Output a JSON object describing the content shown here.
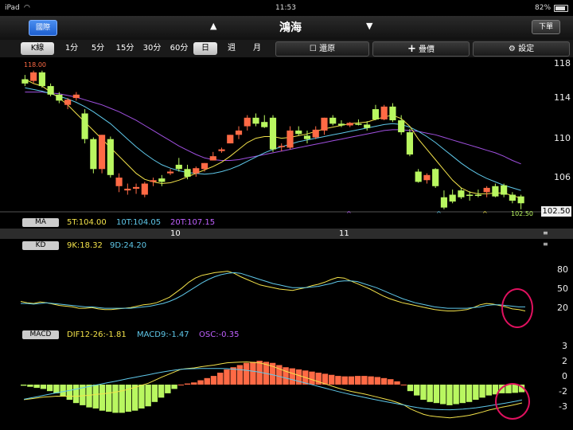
{
  "status": {
    "device": "iPad",
    "time": "11:53",
    "battery": "82%"
  },
  "header": {
    "left_button": "國際",
    "title": "鴻海",
    "right_button": "下單"
  },
  "tabs": [
    {
      "label": "K線",
      "selected": true
    },
    {
      "label": "1分",
      "selected": false
    },
    {
      "label": "5分",
      "selected": false
    },
    {
      "label": "15分",
      "selected": false
    },
    {
      "label": "30分",
      "selected": false
    },
    {
      "label": "60分",
      "selected": false
    },
    {
      "label": "日",
      "selected": true
    },
    {
      "label": "週",
      "selected": false
    },
    {
      "label": "月",
      "selected": false
    }
  ],
  "tools": {
    "restore": "還原",
    "overlay": "疊價",
    "settings": "設定"
  },
  "main": {
    "high_label": "118.00",
    "low_label": "102.50",
    "last_price": "102.50",
    "axis_labels": [
      "118",
      "114",
      "110",
      "106"
    ]
  },
  "ma_legend": {
    "tag": "MA",
    "t5": "5T:104.00",
    "t10": "10T:104.05",
    "t20": "20T:107.15"
  },
  "dates": [
    "10",
    "11"
  ],
  "kd_legend": {
    "tag": "KD",
    "k": "9K:18.32",
    "d": "9D:24.20"
  },
  "kd_axis": [
    "80",
    "50",
    "20"
  ],
  "macd_legend": {
    "tag": "MACD",
    "dif": "DIF12-26:-1.81",
    "macd": "MACD9:-1.47",
    "osc": "OSC:-0.35"
  },
  "macd_axis": [
    "3",
    "2",
    "0",
    "-2",
    "-3"
  ],
  "colors": {
    "up": "#ff6a45",
    "down": "#b9f760",
    "ma5": "#f3e24a",
    "ma10": "#5fc8ea",
    "ma20": "#a050e0",
    "circle": "#e0115f"
  },
  "chart_data": [
    {
      "type": "candlestick",
      "title": "",
      "ylim": [
        101.5,
        119
      ],
      "candles": [
        [
          117,
          117.5,
          116.2,
          116.5
        ],
        [
          116.8,
          118,
          116.5,
          117.8
        ],
        [
          117.8,
          118,
          116,
          116.2
        ],
        [
          116.2,
          116.5,
          115,
          115.2
        ],
        [
          115.2,
          115.5,
          114.2,
          114.5
        ],
        [
          114,
          114.8,
          113.5,
          114.6
        ],
        [
          114.8,
          115.5,
          114.5,
          115.2
        ],
        [
          113,
          113.5,
          109.5,
          110
        ],
        [
          110,
          110.2,
          106,
          106.5
        ],
        [
          106.5,
          110.5,
          106,
          110.5
        ],
        [
          110,
          110.3,
          105.5,
          105.8
        ],
        [
          104.5,
          106,
          103.8,
          105.5
        ],
        [
          104,
          104.8,
          103.5,
          104.2
        ],
        [
          104.2,
          104.8,
          103.6,
          104.4
        ],
        [
          103.5,
          105,
          103.2,
          104.8
        ],
        [
          105,
          105.5,
          104.5,
          105.2
        ],
        [
          105.4,
          105.8,
          104.5,
          105
        ],
        [
          106,
          106.5,
          105.8,
          106.2
        ],
        [
          107,
          107.8,
          106.2,
          106.5
        ],
        [
          106.5,
          107,
          105.3,
          105.6
        ],
        [
          106,
          106.8,
          105.6,
          106.6
        ],
        [
          106.5,
          107.2,
          106.2,
          107.2
        ],
        [
          107.5,
          108.5,
          107.5,
          108
        ],
        [
          108.6,
          109,
          108.4,
          108.8
        ],
        [
          109.5,
          110.5,
          109.5,
          110.5
        ],
        [
          110.5,
          111.5,
          110,
          111
        ],
        [
          111.5,
          112.8,
          111,
          112.5
        ],
        [
          112.5,
          113,
          111.5,
          111.8
        ],
        [
          112,
          112.8,
          111.3,
          111.4
        ],
        [
          112.5,
          112.8,
          108.5,
          108.8
        ],
        [
          109.2,
          109.5,
          108.6,
          109.2
        ],
        [
          109,
          111.5,
          108.8,
          111
        ],
        [
          111,
          111.5,
          110.4,
          110.6
        ],
        [
          110.4,
          111,
          109.5,
          110
        ],
        [
          110.2,
          111.5,
          110,
          111.1
        ],
        [
          111,
          112.5,
          110.5,
          112.5
        ],
        [
          112.5,
          112.8,
          111.6,
          111.8
        ],
        [
          111.8,
          112.2,
          111.4,
          111.6
        ],
        [
          111.6,
          112,
          111.4,
          111.9
        ],
        [
          111.8,
          112.3,
          111.6,
          111.7
        ],
        [
          111.7,
          112.1,
          111,
          111.3
        ],
        [
          113.5,
          114,
          112.2,
          112.3
        ],
        [
          112.3,
          114,
          112.2,
          113.8
        ],
        [
          113.8,
          114.2,
          112,
          112.2
        ],
        [
          112.2,
          112.8,
          110.5,
          110.8
        ],
        [
          110.8,
          111.2,
          108,
          108.2
        ],
        [
          106.2,
          106.5,
          104.9,
          105
        ],
        [
          105.2,
          106,
          104.8,
          105.8
        ],
        [
          106.5,
          106.6,
          104.3,
          104.5
        ],
        [
          103.2,
          104,
          101.8,
          102
        ],
        [
          103.5,
          104.1,
          102.5,
          102.7
        ],
        [
          104,
          104.3,
          103,
          103.2
        ],
        [
          103.5,
          103.9,
          102.8,
          103.4
        ],
        [
          103.5,
          104.1,
          103.2,
          103.4
        ],
        [
          103.8,
          104.5,
          103.2,
          104.3
        ],
        [
          104.5,
          104.8,
          103.2,
          103.3
        ],
        [
          104.6,
          104.8,
          103.2,
          103.5
        ],
        [
          103.5,
          103.8,
          102.5,
          102.8
        ],
        [
          103.3,
          103.5,
          101.8,
          102.5
        ]
      ],
      "ma5": [
        117,
        116.5,
        116.2,
        115.5,
        114.8,
        114,
        113,
        112,
        111,
        110,
        109,
        108,
        107,
        106,
        105.3,
        105,
        104.8,
        104.9,
        105.2,
        105.6,
        106,
        106.4,
        106.8,
        107.3,
        108,
        108.8,
        109.6,
        110.1,
        110.3,
        110.3,
        110.1,
        110.2,
        110.4,
        110.6,
        110.9,
        111.2,
        111.4,
        111.6,
        111.8,
        111.9,
        112,
        112.3,
        112.6,
        112.8,
        112.4,
        111.5,
        110,
        108.8,
        107.6,
        106.4,
        105.2,
        104.3,
        103.8,
        103.6,
        103.6,
        103.7,
        103.7,
        103.4,
        103.1
      ],
      "ma10": [
        116,
        115.8,
        115.6,
        115.3,
        115,
        114.7,
        114.3,
        113.8,
        113.2,
        112.5,
        111.8,
        110.9,
        110,
        109.1,
        108.3,
        107.6,
        107,
        106.6,
        106.3,
        106.1,
        106,
        105.9,
        106,
        106.2,
        106.5,
        106.9,
        107.4,
        107.9,
        108.4,
        108.8,
        109.1,
        109.4,
        109.7,
        109.9,
        110.1,
        110.3,
        110.5,
        110.7,
        110.9,
        111.1,
        111.3,
        111.5,
        111.7,
        111.8,
        111.7,
        111.4,
        110.9,
        110.3,
        109.6,
        108.8,
        108,
        107.2,
        106.5,
        105.9,
        105.4,
        105,
        104.6,
        104.3,
        104
      ],
      "ma20": [
        115.5,
        115.5,
        115.5,
        115.4,
        115.3,
        115.1,
        114.9,
        114.6,
        114.3,
        114,
        113.6,
        113.2,
        112.7,
        112.2,
        111.6,
        111,
        110.4,
        109.8,
        109.2,
        108.7,
        108.2,
        107.8,
        107.6,
        107.5,
        107.5,
        107.6,
        107.8,
        108,
        108.2,
        108.4,
        108.6,
        108.8,
        109,
        109.2,
        109.4,
        109.6,
        109.8,
        110,
        110.2,
        110.4,
        110.6,
        110.8,
        111,
        111.1,
        111.1,
        111,
        110.9,
        110.7,
        110.5,
        110.2,
        109.9,
        109.6,
        109.3,
        109,
        108.7,
        108.4,
        108,
        107.5,
        107.1
      ]
    },
    {
      "type": "line",
      "title": "",
      "ylim": [
        0,
        100
      ],
      "series": [
        {
          "name": "9K",
          "values": [
            32,
            30,
            29,
            31,
            30,
            28,
            26,
            25,
            24,
            22,
            22,
            23,
            21,
            20,
            20,
            21,
            22,
            23,
            25,
            27,
            28,
            30,
            34,
            38,
            45,
            52,
            60,
            66,
            70,
            72,
            74,
            75,
            76,
            73,
            68,
            64,
            60,
            56,
            54,
            52,
            50,
            49,
            48,
            50,
            52,
            55,
            57,
            60,
            64,
            67,
            66,
            62,
            58,
            54,
            50,
            45,
            40,
            36,
            33,
            30,
            28,
            26,
            24,
            22,
            20,
            19,
            18,
            18,
            19,
            20,
            23,
            27,
            29,
            28,
            26,
            24,
            21,
            20,
            18
          ]
        },
        {
          "name": "9D",
          "values": [
            29,
            29,
            28,
            29,
            30,
            29,
            28,
            27,
            26,
            25,
            24,
            24,
            23,
            22,
            22,
            22,
            22,
            22,
            23,
            24,
            25,
            27,
            29,
            32,
            36,
            41,
            47,
            53,
            59,
            64,
            68,
            71,
            73,
            74,
            73,
            70,
            67,
            64,
            61,
            58,
            56,
            54,
            52,
            52,
            52,
            53,
            54,
            56,
            58,
            61,
            62,
            62,
            61,
            58,
            55,
            52,
            48,
            44,
            40,
            36,
            33,
            30,
            28,
            26,
            24,
            23,
            22,
            22,
            22,
            22,
            23,
            24,
            26,
            27,
            27,
            26,
            25,
            24,
            24
          ]
        }
      ]
    },
    {
      "type": "bar",
      "title": "",
      "ylim": [
        -3.5,
        3.5
      ],
      "osc": [
        -0.05,
        -0.1,
        -0.15,
        -0.2,
        -0.3,
        -0.4,
        -0.55,
        -0.7,
        -0.85,
        -0.95,
        -1.05,
        -1.1,
        -1.2,
        -1.25,
        -1.3,
        -1.3,
        -1.25,
        -1.2,
        -1.1,
        -1,
        -0.8,
        -0.6,
        -0.4,
        -0.2,
        0,
        0.05,
        0.1,
        0.2,
        0.3,
        0.4,
        0.55,
        0.7,
        0.8,
        0.9,
        1.0,
        1.05,
        1.1,
        1.05,
        1.0,
        0.9,
        0.8,
        0.75,
        0.7,
        0.65,
        0.6,
        0.55,
        0.5,
        0.45,
        0.4,
        0.38,
        0.38,
        0.4,
        0.4,
        0.38,
        0.35,
        0.3,
        0.25,
        0.15,
        0,
        -0.3,
        -0.5,
        -0.7,
        -0.8,
        -0.85,
        -0.9,
        -0.95,
        -0.9,
        -0.85,
        -0.8,
        -0.7,
        -0.6,
        -0.5,
        -0.45,
        -0.4,
        -0.4,
        -0.38,
        -0.35
      ]
    }
  ]
}
